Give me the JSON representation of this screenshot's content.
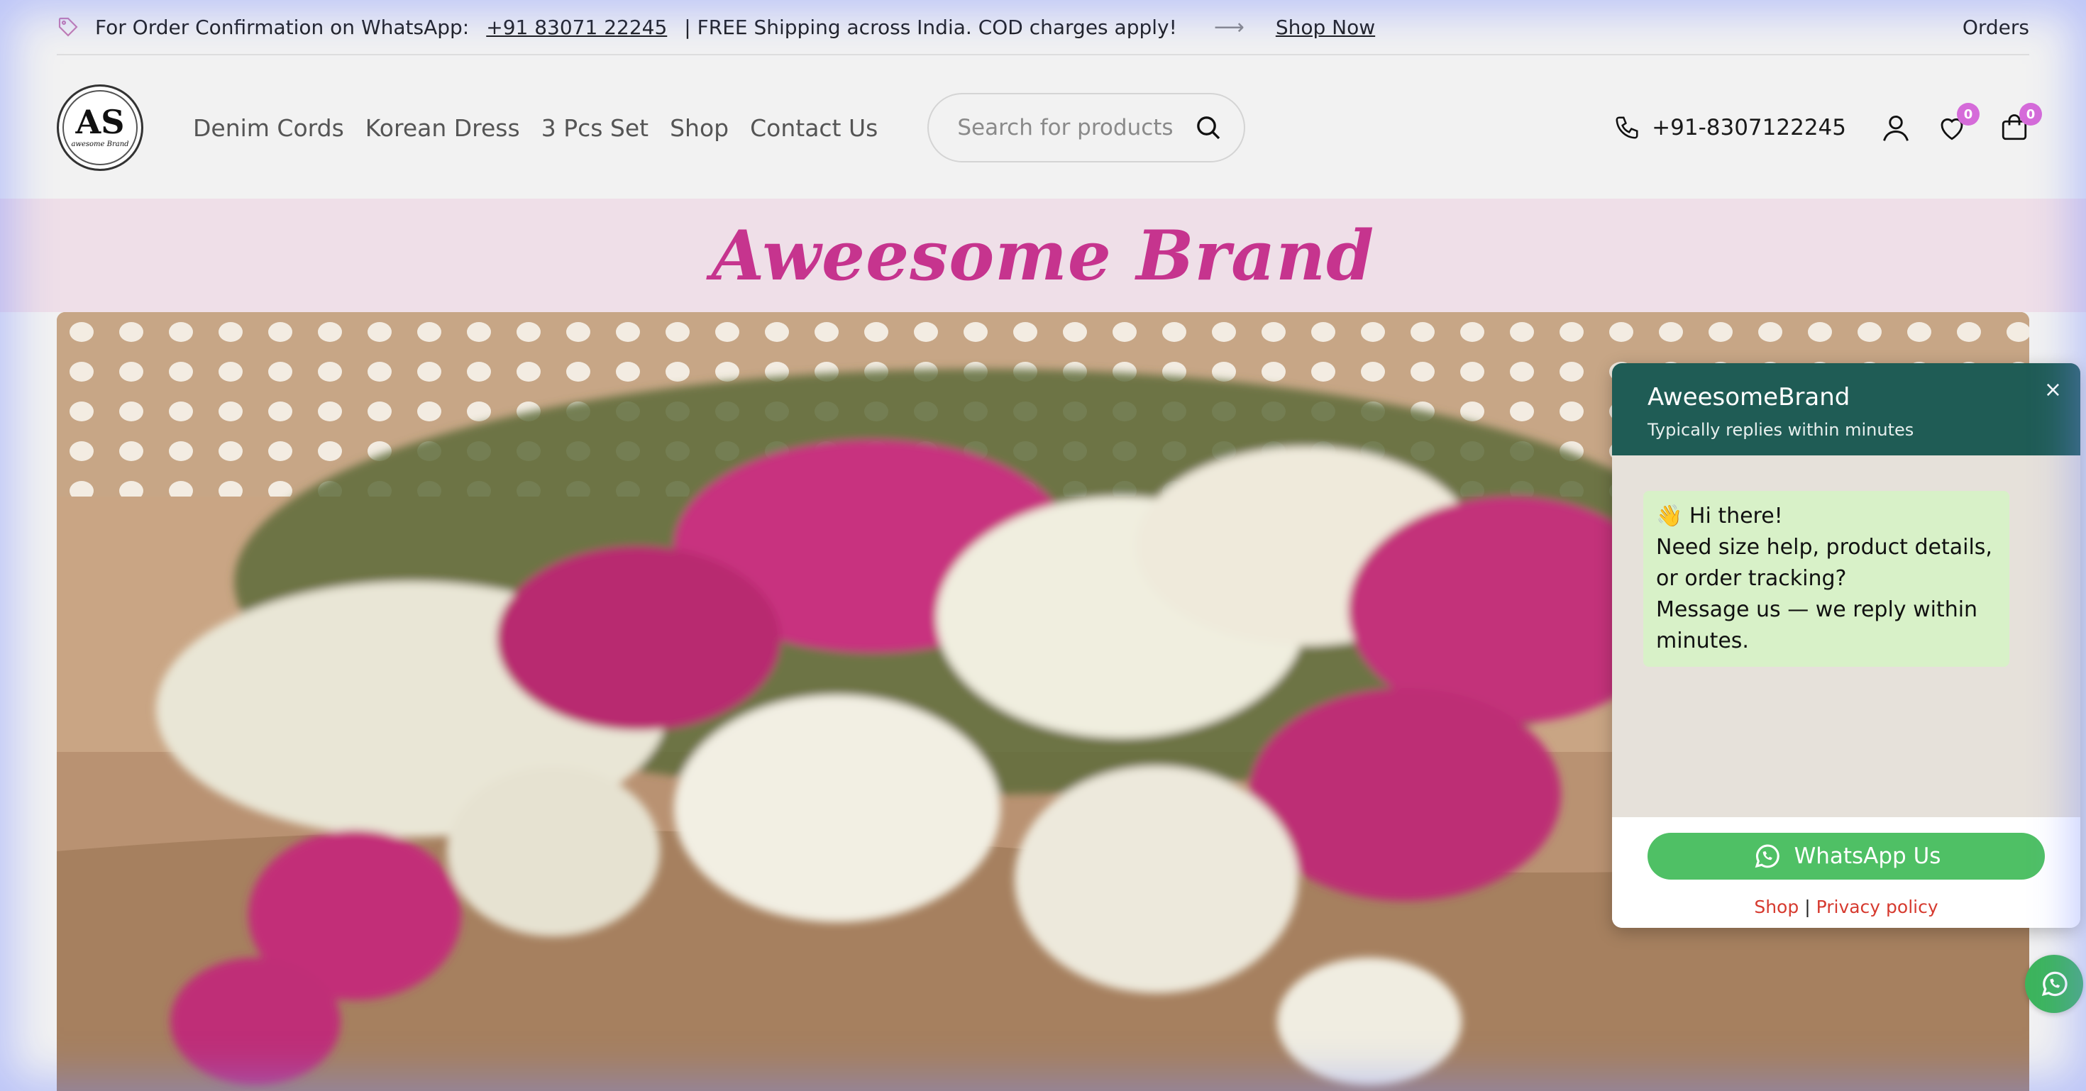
{
  "announcement": {
    "lead_text": "For Order Confirmation on WhatsApp:",
    "phone": "+91 83071 22245",
    "shipping_text": "| FREE Shipping across India. COD charges apply!",
    "cta": "Shop Now",
    "orders": "Orders"
  },
  "header": {
    "logo_letters": "AS",
    "logo_script": "awesome Brand",
    "nav": [
      "Denim Cords",
      "Korean Dress",
      "3 Pcs Set",
      "Shop",
      "Contact Us"
    ],
    "search_placeholder": "Search for products",
    "phone": "+91-8307122245",
    "wishlist_count": "0",
    "cart_count": "0"
  },
  "brand": {
    "title": "Aweesome Brand"
  },
  "whatsapp_popup": {
    "name": "AweesomeBrand",
    "subtitle": "Typically replies within minutes",
    "close": "×",
    "message_lines": [
      "👋 Hi there!",
      "Need size help, product details, or order tracking?",
      "Message us — we reply within minutes."
    ],
    "button": "WhatsApp Us",
    "link_shop": "Shop",
    "link_divider": "|",
    "link_privacy": "Privacy policy"
  },
  "colors": {
    "brand_pink": "#c6348e",
    "band_bg": "#efdfe8",
    "wa_header": "#1f5c55",
    "wa_green": "#4fc065",
    "badge": "#d56bd9"
  }
}
